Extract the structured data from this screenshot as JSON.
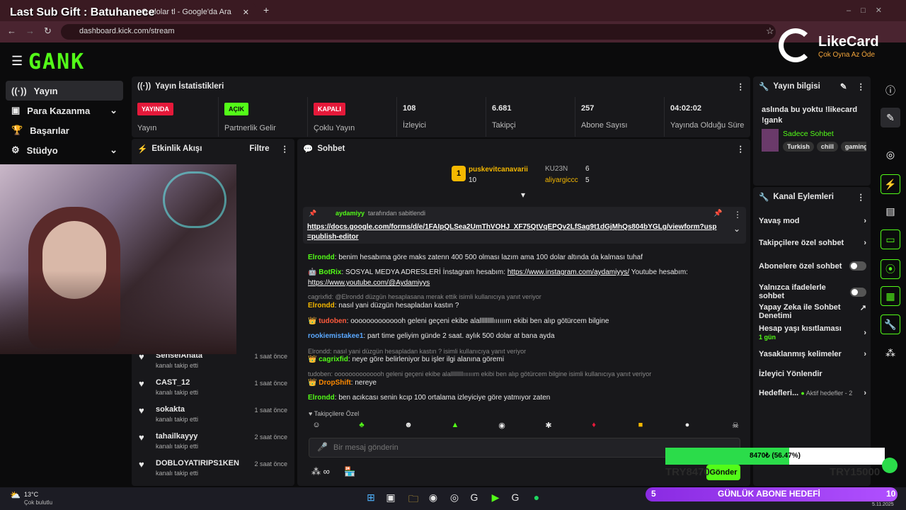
{
  "overlay": {
    "sub_gift": "Last Sub Gift : Batuhanece",
    "likecard_brand": "LikeCard",
    "likecard_tag": "Çok Oyna  Az Öde",
    "goal_amount": "8470₺ (56.47%)",
    "goal_progress": 0.5647,
    "goal_target": "TRY15000",
    "goal_current": "TRY8470",
    "goal_label": "GÜNLÜK ABONE HEDEFİ",
    "goal_count": "5",
    "goal_count2": "10"
  },
  "browser": {
    "tab2_title": "dolar tl - Google'da Ara",
    "url": "dashboard.kick.com/stream"
  },
  "sidebar": {
    "items": [
      {
        "label": "Yayın"
      },
      {
        "label": "Para Kazanma"
      },
      {
        "label": "Başarılar"
      },
      {
        "label": "Stüdyo"
      }
    ]
  },
  "stats": {
    "title": "Yayın İstatistikleri",
    "cards": [
      {
        "badge": "YAYINDA",
        "label": "Yayın"
      },
      {
        "badge": "AÇIK",
        "label": "Partnerlik Gelir"
      },
      {
        "badge": "KAPALI",
        "label": "Çoklu Yayın"
      },
      {
        "value": "108",
        "label": "İzleyici"
      },
      {
        "value": "6.681",
        "label": "Takipçi"
      },
      {
        "value": "257",
        "label": "Abone Sayısı"
      },
      {
        "value": "04:02:02",
        "label": "Yayında Olduğu Süre"
      }
    ]
  },
  "activity": {
    "title": "Etkinlik Akışı",
    "filter": "Filtre",
    "items": [
      {
        "name": "SenseiAhata",
        "sub": "kanalı takip etti",
        "time": "1 saat önce"
      },
      {
        "name": "CAST_12",
        "sub": "kanalı takip etti",
        "time": "1 saat önce"
      },
      {
        "name": "sokakta",
        "sub": "kanalı takip etti",
        "time": "1 saat önce"
      },
      {
        "name": "tahailkayyy",
        "sub": "kanalı takip etti",
        "time": "2 saat önce"
      },
      {
        "name": "DOBLOYATIRIPS1KEN",
        "sub": "kanalı takip etti",
        "time": "2 saat önce"
      }
    ]
  },
  "chat": {
    "title": "Sohbet",
    "leaders": [
      {
        "rank": "1",
        "name": "puskevitcanavarii",
        "count": "10"
      },
      {
        "name": "KU23N",
        "count": "6"
      },
      {
        "name": "aliyargiccc",
        "count": "5"
      }
    ],
    "pinned": {
      "by": "aydamiyy",
      "by_suffix": "tarafından sabitlendi",
      "link": "https://docs.google.com/forms/d/e/1FAIpQLSea2UmThVOHJ_XF75QtVqEPQv2LfSag9t1dGjMhQs804bYGLg/viewform?usp=publish-editor"
    },
    "messages": [
      {
        "user": "Elrondd",
        "text": ": benim hesabıma göre maks zatenn 400 500 olması lazım ama 100 dolar altında da kalması tuhaf"
      },
      {
        "user": "BotRix",
        "text": ": SOSYAL MEDYA ADRESLERİ İnstagram hesabım: ",
        "link1": "https://www.instagram.com/aydamiyys/",
        "mid": " Youtube hesabım:",
        "link2": "https://www.youtube.com/@Aydamiyys"
      },
      {
        "reply": "cagrixfid: @Elrondd düzgün hesaplasana merak ettik isimli kullanıcıya yanıt veriyor",
        "user": "Elrondd",
        "text": ": nasıl yani düzgün hesapladan kastın ?"
      },
      {
        "user": "tudoben",
        "text": ": oooooooooooooh geleni geçeni ekibe alalllllllllıııııım ekibi ben alıp götürcem bilgine"
      },
      {
        "user": "rookiemistakee1",
        "text": ": part time geliyim günde 2 saat. aylık 500 dolar at bana ayda"
      },
      {
        "reply": "Elrondd: nasıl yani düzgün hesapladan kastın ? isimli kullanıcıya yanıt veriyor",
        "user": "cagrixfid",
        "text": ": neye göre belirleniyor bu işler ilgi alanına göremi"
      },
      {
        "reply": "tudoben: oooooooooooooh geleni geçeni ekibe alalllllllllıııııım ekibi ben alıp götürcem bilgine isimli kullanıcıya yanıt veriyor",
        "user": "DropShift",
        "text": ": nereye"
      },
      {
        "user": "Elrondd",
        "text": ": ben acıkcası senin kcıp 100 ortalama izleyiciye göre yatmıyor zaten"
      }
    ],
    "emote_title": "Takipçilere Özel",
    "input_placeholder": "Bir mesaj gönderin",
    "send": "Gönder"
  },
  "info": {
    "title": "Yayın bilgisi",
    "stream_title": "aslında bu yoktu !likecard !gank",
    "category": "Sadece Sohbet",
    "tags": [
      "Turkish",
      "chill",
      "gaming"
    ]
  },
  "actions": {
    "title": "Kanal Eylemleri",
    "items": [
      {
        "label": "Yavaş mod"
      },
      {
        "label": "Takipçilere özel sohbet"
      },
      {
        "label": "Abonelere özel sohbet"
      },
      {
        "label": "Yalnızca ifadelerle sohbet"
      },
      {
        "label": "Yapay Zeka ile Sohbet Denetimi"
      },
      {
        "label": "Hesap yaşı kısıtlaması",
        "sub": "1 gün"
      },
      {
        "label": "Yasaklanmış kelimeler"
      },
      {
        "label": "İzleyici Yönlendir"
      },
      {
        "label": "Hedefleri...",
        "sub": "Aktif hedefler - 2"
      }
    ]
  },
  "weather": {
    "temp": "13°C",
    "desc": "Çok bulutlu"
  },
  "clock": {
    "date": "5.11.2025"
  },
  "colors": {
    "kick_green": "#53fc18",
    "live_red": "#e5193a",
    "bg": "#0b0b0c",
    "panel": "#18181b"
  }
}
